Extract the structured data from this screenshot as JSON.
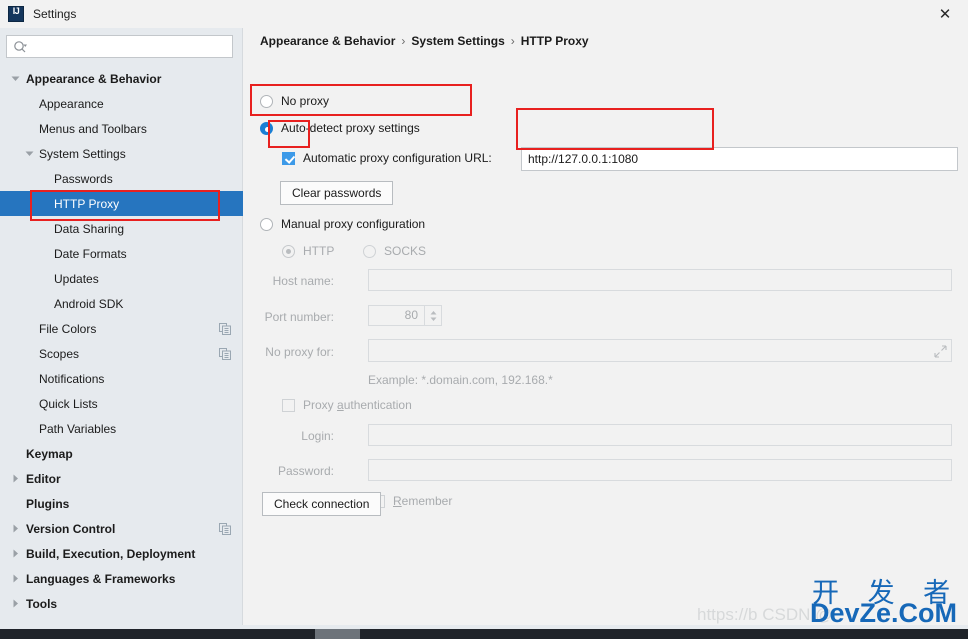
{
  "window": {
    "title": "Settings",
    "app_icon": "intellij-idea-icon",
    "close_label": "✕"
  },
  "sidebar": {
    "search": {
      "placeholder": "",
      "value": "",
      "icon": "search-icon"
    },
    "items": [
      {
        "label": "Appearance & Behavior",
        "indent": 26,
        "bold": true,
        "twisty": "down",
        "selected": false,
        "copy_icon": false
      },
      {
        "label": "Appearance",
        "indent": 39,
        "bold": false,
        "twisty": "none",
        "selected": false,
        "copy_icon": false
      },
      {
        "label": "Menus and Toolbars",
        "indent": 39,
        "bold": false,
        "twisty": "none",
        "selected": false,
        "copy_icon": false
      },
      {
        "label": "System Settings",
        "indent": 39,
        "bold": false,
        "twisty": "down2",
        "selected": false,
        "copy_icon": false
      },
      {
        "label": "Passwords",
        "indent": 54,
        "bold": false,
        "twisty": "none",
        "selected": false,
        "copy_icon": false
      },
      {
        "label": "HTTP Proxy",
        "indent": 54,
        "bold": false,
        "twisty": "none",
        "selected": true,
        "copy_icon": false
      },
      {
        "label": "Data Sharing",
        "indent": 54,
        "bold": false,
        "twisty": "none",
        "selected": false,
        "copy_icon": false
      },
      {
        "label": "Date Formats",
        "indent": 54,
        "bold": false,
        "twisty": "none",
        "selected": false,
        "copy_icon": false
      },
      {
        "label": "Updates",
        "indent": 54,
        "bold": false,
        "twisty": "none",
        "selected": false,
        "copy_icon": false
      },
      {
        "label": "Android SDK",
        "indent": 54,
        "bold": false,
        "twisty": "none",
        "selected": false,
        "copy_icon": false
      },
      {
        "label": "File Colors",
        "indent": 39,
        "bold": false,
        "twisty": "none",
        "selected": false,
        "copy_icon": true
      },
      {
        "label": "Scopes",
        "indent": 39,
        "bold": false,
        "twisty": "none",
        "selected": false,
        "copy_icon": true
      },
      {
        "label": "Notifications",
        "indent": 39,
        "bold": false,
        "twisty": "none",
        "selected": false,
        "copy_icon": false
      },
      {
        "label": "Quick Lists",
        "indent": 39,
        "bold": false,
        "twisty": "none",
        "selected": false,
        "copy_icon": false
      },
      {
        "label": "Path Variables",
        "indent": 39,
        "bold": false,
        "twisty": "none",
        "selected": false,
        "copy_icon": false
      },
      {
        "label": "Keymap",
        "indent": 26,
        "bold": true,
        "twisty": "none",
        "selected": false,
        "copy_icon": false
      },
      {
        "label": "Editor",
        "indent": 26,
        "bold": true,
        "twisty": "right",
        "selected": false,
        "copy_icon": false
      },
      {
        "label": "Plugins",
        "indent": 26,
        "bold": true,
        "twisty": "none",
        "selected": false,
        "copy_icon": false
      },
      {
        "label": "Version Control",
        "indent": 26,
        "bold": true,
        "twisty": "right",
        "selected": false,
        "copy_icon": true
      },
      {
        "label": "Build, Execution, Deployment",
        "indent": 26,
        "bold": true,
        "twisty": "right",
        "selected": false,
        "copy_icon": false
      },
      {
        "label": "Languages & Frameworks",
        "indent": 26,
        "bold": true,
        "twisty": "right",
        "selected": false,
        "copy_icon": false
      },
      {
        "label": "Tools",
        "indent": 26,
        "bold": true,
        "twisty": "right",
        "selected": false,
        "copy_icon": false
      }
    ]
  },
  "content": {
    "breadcrumb": {
      "part1": "Appearance & Behavior",
      "sep1": "›",
      "part2": "System Settings",
      "sep2": "›",
      "part3": "HTTP Proxy"
    },
    "no_proxy_label": "No proxy",
    "auto_detect_label": "Auto-detect proxy settings",
    "auto_config_label": "Automatic proxy configuration URL:",
    "auto_config_url": "http://127.0.0.1:1080",
    "clear_passwords_label": "Clear passwords",
    "manual_label": "Manual proxy configuration",
    "http_label": "HTTP",
    "socks_label": "SOCKS",
    "host_name_label": "Host name:",
    "host_name_value": "",
    "port_number_label": "Port number:",
    "port_number_value": "80",
    "no_proxy_for_label": "No proxy for:",
    "no_proxy_for_value": "",
    "example_hint": "Example: *.domain.com, 192.168.*",
    "proxy_auth_label_pre": "Proxy ",
    "proxy_auth_label_u": "a",
    "proxy_auth_label_post": "uthentication",
    "login_label": "Login:",
    "login_value": "",
    "password_label": "Password:",
    "password_value": "",
    "remember_label_u": "R",
    "remember_label_post": "emember",
    "check_connection_label": "Check connection"
  },
  "watermark": {
    "csdn": "https://b CSDN @",
    "chinese": "开 发 者",
    "site": "DevZe.CoM"
  },
  "colors": {
    "selection_blue": "#2675bf",
    "accent_blue": "#1a7fd4",
    "checkbox_blue": "#3d9ae8",
    "annotation_red": "#e8201f",
    "watermark_blue": "#1668b8",
    "sidebar_bg": "#e6eaee",
    "content_bg": "#f2f2f2"
  }
}
